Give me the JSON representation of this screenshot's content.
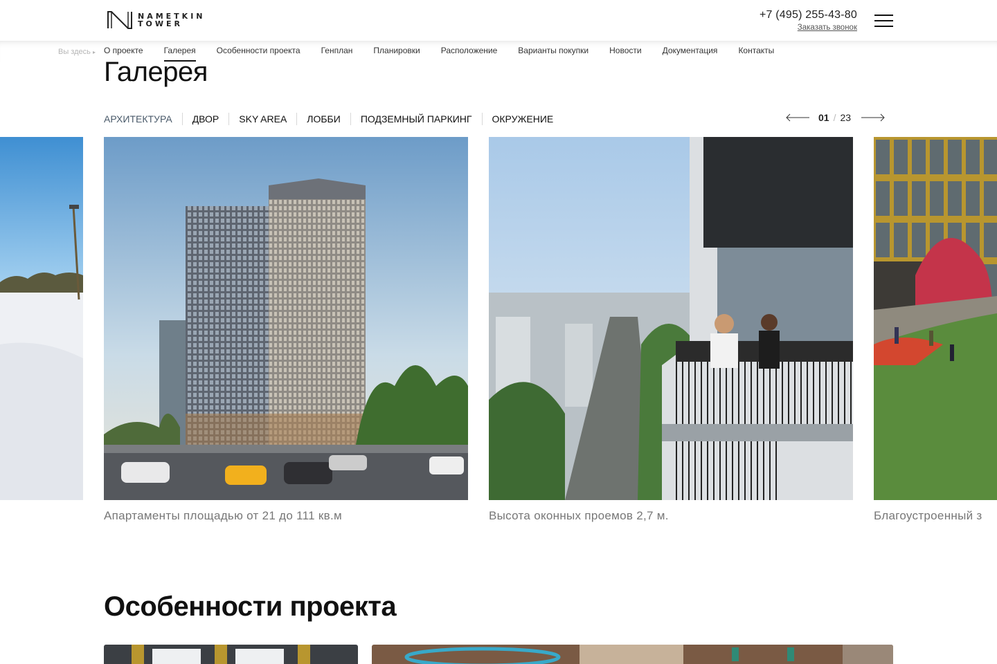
{
  "header": {
    "logo_line1": "NAMETKIN",
    "logo_line2": "TOWER",
    "phone": "+7 (495) 255-43-80",
    "callback_label": "Заказать звонок"
  },
  "subnav": {
    "breadcrumb_hint": "Вы здесь",
    "items": [
      {
        "label": "О проекте"
      },
      {
        "label": "Галерея",
        "active": true
      },
      {
        "label": "Особенности проекта"
      },
      {
        "label": "Генплан"
      },
      {
        "label": "Планировки"
      },
      {
        "label": "Расположение"
      },
      {
        "label": "Варианты покупки"
      },
      {
        "label": "Новости"
      },
      {
        "label": "Документация"
      },
      {
        "label": "Контакты"
      }
    ]
  },
  "gallery": {
    "title": "Галерея",
    "tabs": [
      {
        "label": "АРХИТЕКТУРА",
        "active": true
      },
      {
        "label": "ДВОР"
      },
      {
        "label": "SKY AREA"
      },
      {
        "label": "ЛОББИ"
      },
      {
        "label": "ПОДЗЕМНЫЙ ПАРКИНГ"
      },
      {
        "label": "ОКРУЖЕНИЕ"
      }
    ],
    "pager": {
      "current": "01",
      "separator": "/",
      "total": "23"
    },
    "slides": [
      {
        "name": "winter-park-photo",
        "caption": ""
      },
      {
        "name": "tower-exterior-render",
        "caption": "Апартаменты площадью от 21 до 111 кв.м"
      },
      {
        "name": "balcony-view-render",
        "caption": "Высота оконных проемов 2,7 м."
      },
      {
        "name": "courtyard-render",
        "caption": "Благоустроенный з"
      }
    ]
  },
  "features": {
    "title": "Особенности проекта"
  },
  "colors": {
    "accent_text": "#4a5a6a",
    "caption": "#777777",
    "background": "#ffffff"
  }
}
